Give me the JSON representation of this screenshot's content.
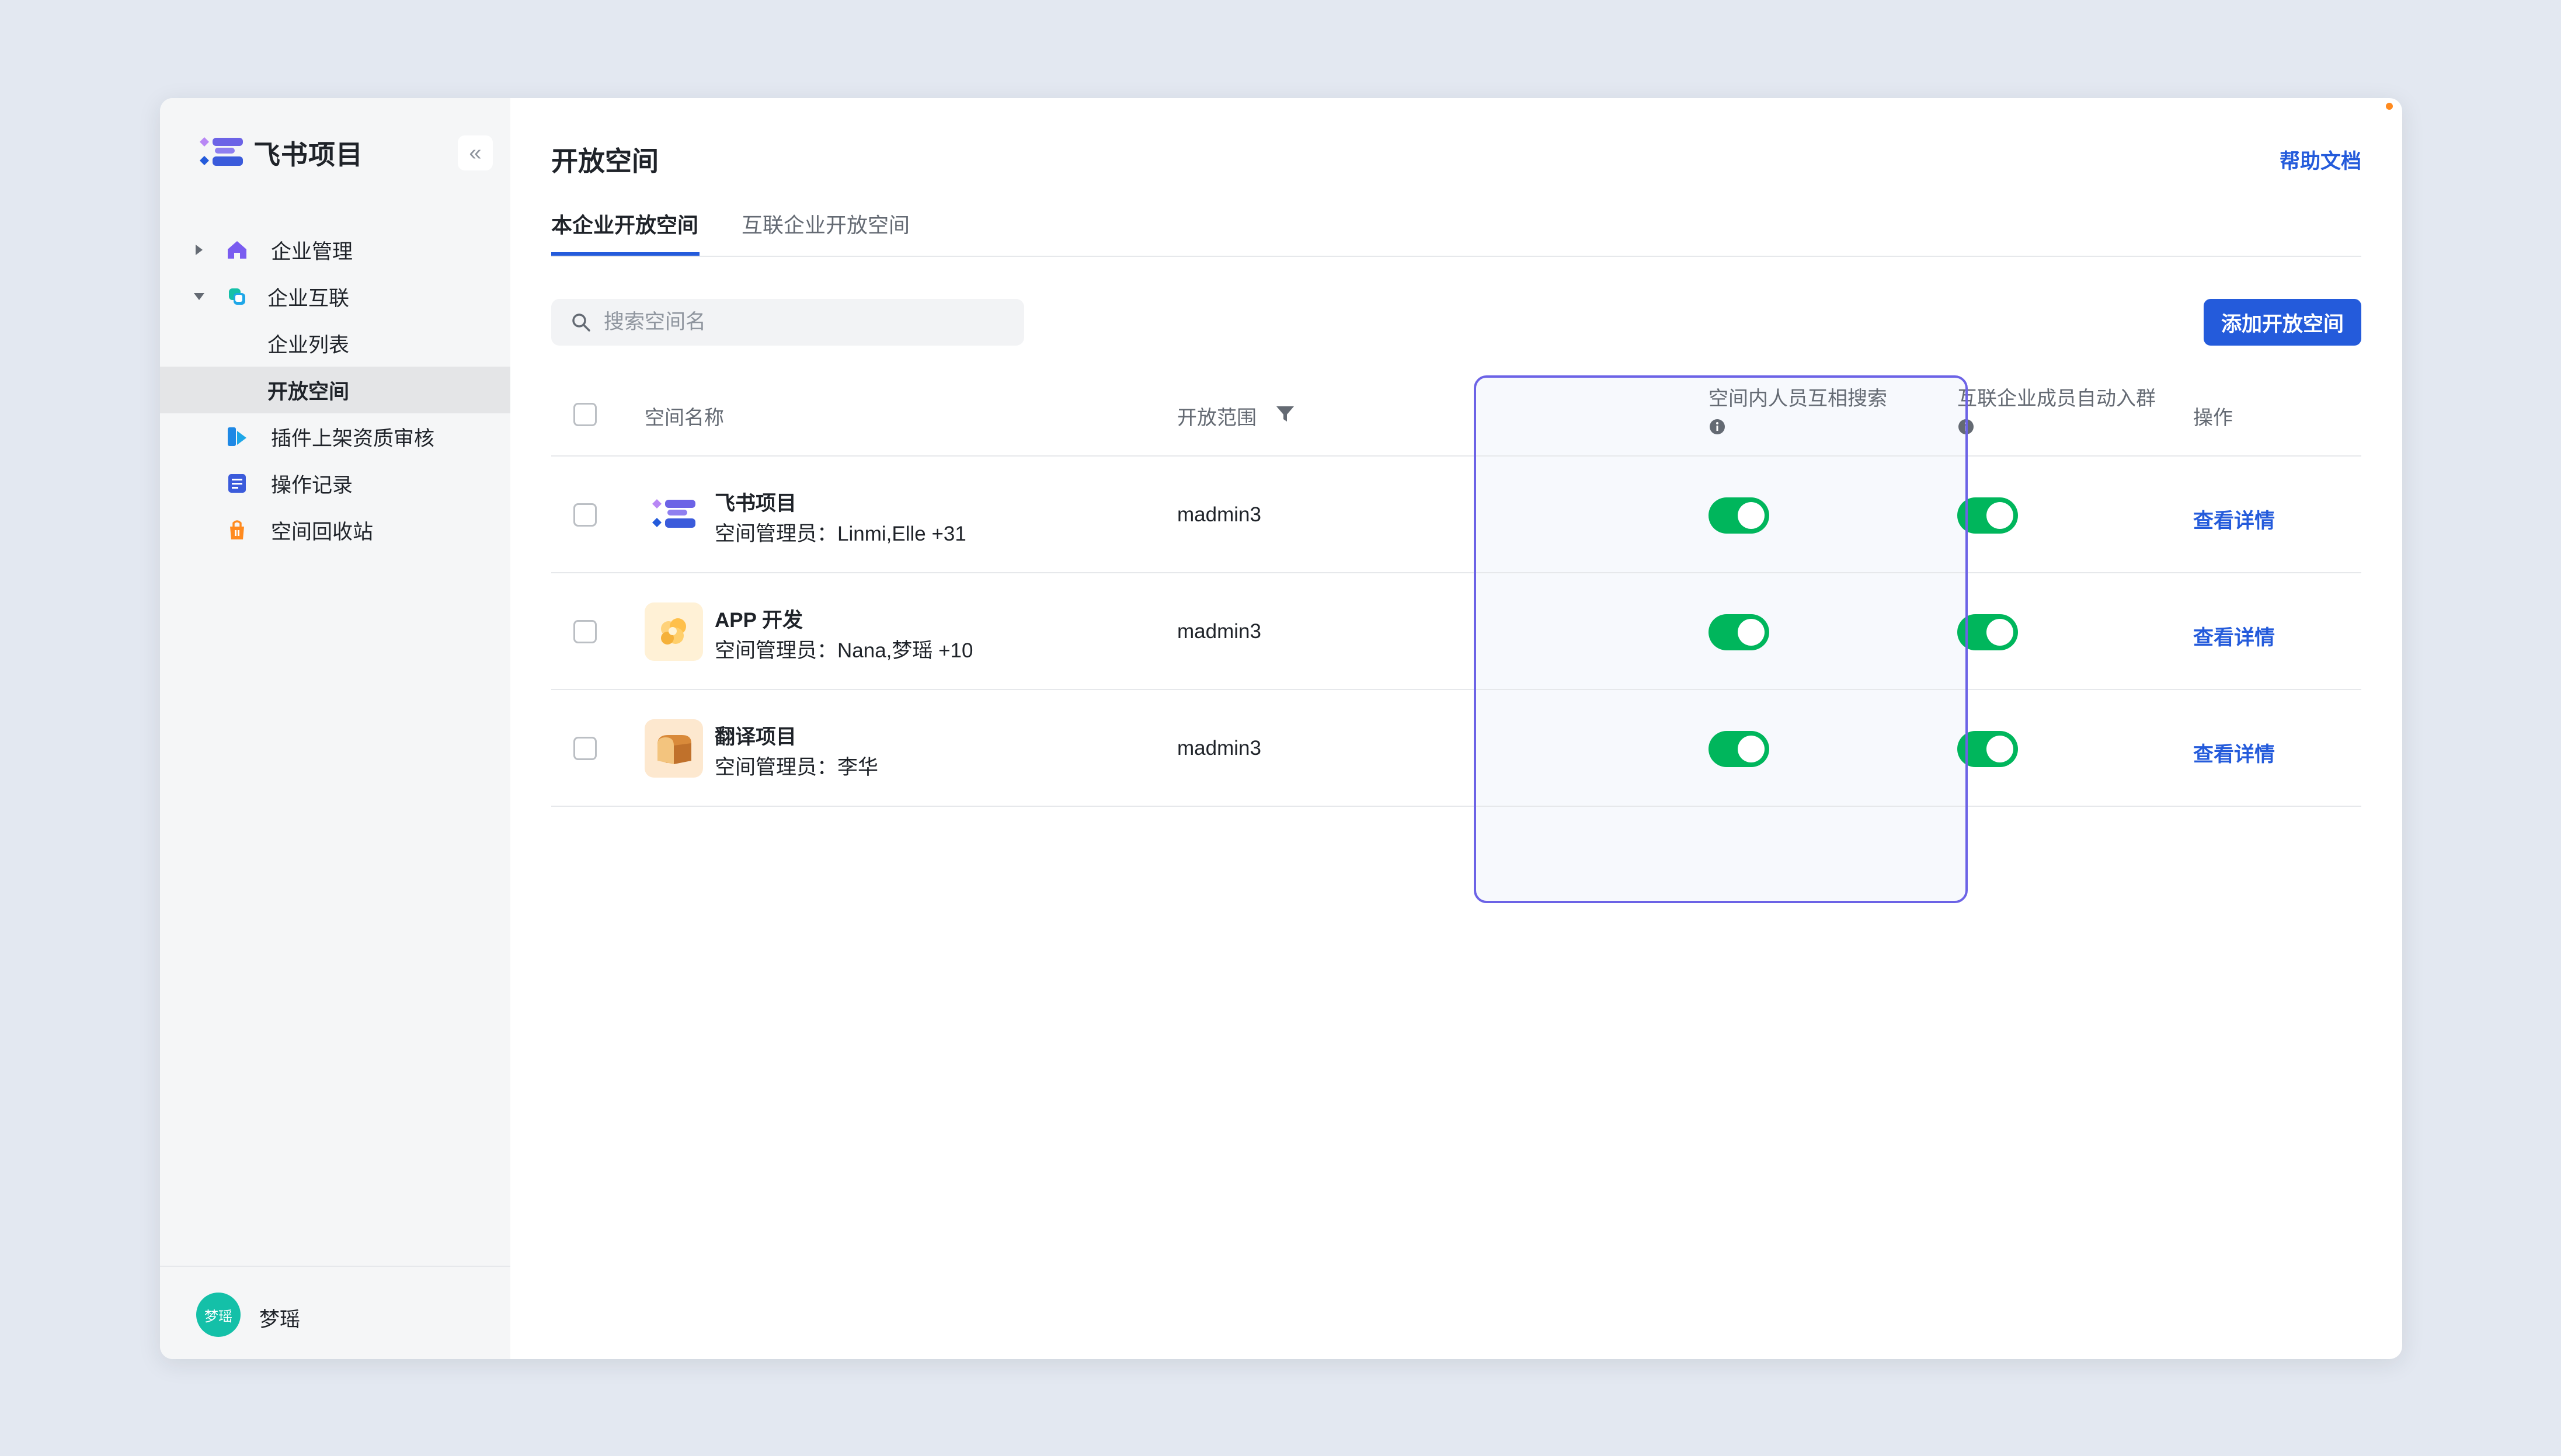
{
  "app": {
    "brand_name": "飞书项目",
    "brand_colors": {
      "primary": "#6c63e6",
      "secondary": "#245bdb",
      "accent": "#b887f5"
    }
  },
  "sidebar": {
    "collapse_icon": "double-chevron-left-icon",
    "items": [
      {
        "label": "企业管理",
        "icon": "home-icon",
        "expandable": true,
        "expanded": false
      },
      {
        "label": "企业互联",
        "icon": "link-icon",
        "expandable": true,
        "expanded": true
      },
      {
        "label": "企业列表",
        "sub": true
      },
      {
        "label": "开放空间",
        "sub": true,
        "active": true
      },
      {
        "label": "插件上架资质审核",
        "icon": "plugin-review-icon"
      },
      {
        "label": "操作记录",
        "icon": "document-icon"
      },
      {
        "label": "空间回收站",
        "icon": "trash-bag-icon"
      }
    ],
    "user": {
      "avatar_text": "梦瑶",
      "name": "梦瑶"
    }
  },
  "header": {
    "title": "开放空间",
    "help_link": "帮助文档"
  },
  "tabs": [
    {
      "label": "本企业开放空间",
      "active": true
    },
    {
      "label": "互联企业开放空间",
      "active": false
    }
  ],
  "search": {
    "placeholder": "搜索空间名",
    "value": ""
  },
  "toolbar": {
    "add_label": "添加开放空间"
  },
  "table": {
    "columns": {
      "name": "空间名称",
      "scope": "开放范围",
      "mutual_search": "空间内人员互相搜索",
      "auto_join": "互联企业成员自动入群",
      "action": "操作"
    },
    "rows": [
      {
        "name": "飞书项目",
        "admin": "空间管理员：Linmi,Elle +31",
        "scope": "madmin3",
        "mutual_search": true,
        "auto_join": true,
        "action": "查看详情",
        "icon": "feishu-project-logo"
      },
      {
        "name": "APP 开发",
        "admin": "空间管理员：Nana,梦瑶 +10",
        "scope": "madmin3",
        "mutual_search": true,
        "auto_join": true,
        "action": "查看详情",
        "icon": "popcorn-icon"
      },
      {
        "name": "翻译项目",
        "admin": "空间管理员：李华",
        "scope": "madmin3",
        "mutual_search": true,
        "auto_join": true,
        "action": "查看详情",
        "icon": "bread-icon"
      }
    ]
  },
  "colors": {
    "toggle_on": "#00b65c",
    "link": "#245bdb",
    "highlight_border": "#6c63e6"
  }
}
